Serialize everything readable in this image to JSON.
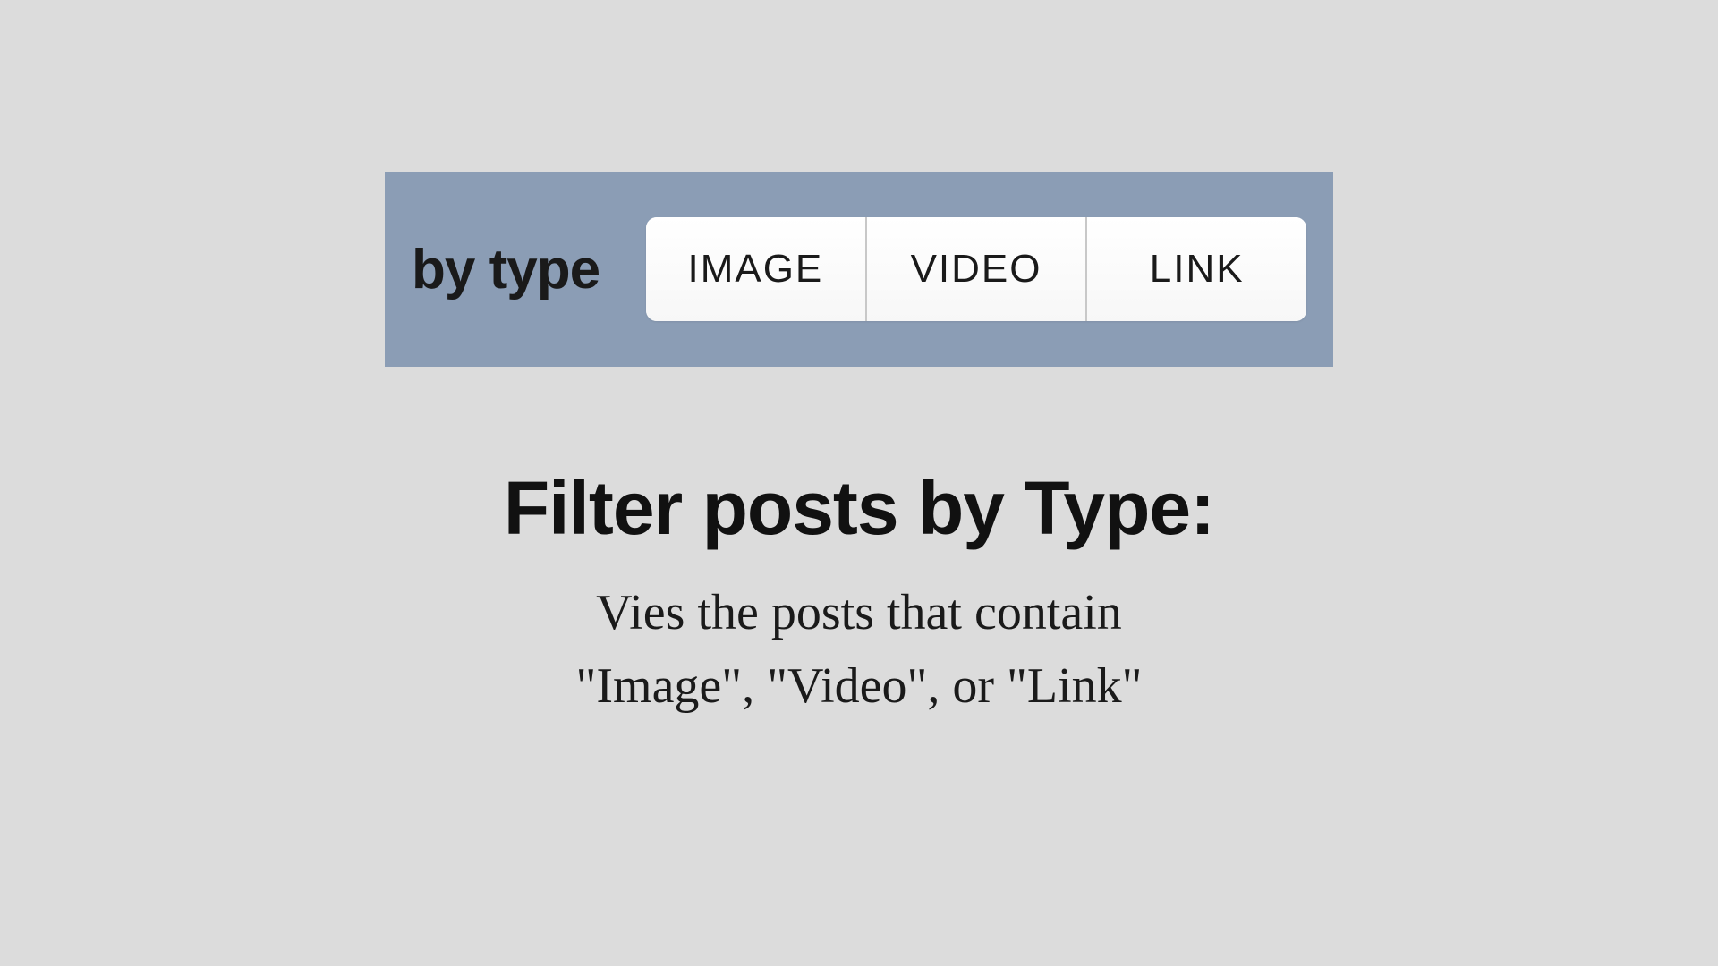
{
  "filter": {
    "label": "by type",
    "options": [
      "IMAGE",
      "VIDEO",
      "LINK"
    ]
  },
  "heading": "Filter posts by Type:",
  "description_line1": "Vies the posts that contain",
  "description_line2": "\"Image\", \"Video\", or \"Link\""
}
